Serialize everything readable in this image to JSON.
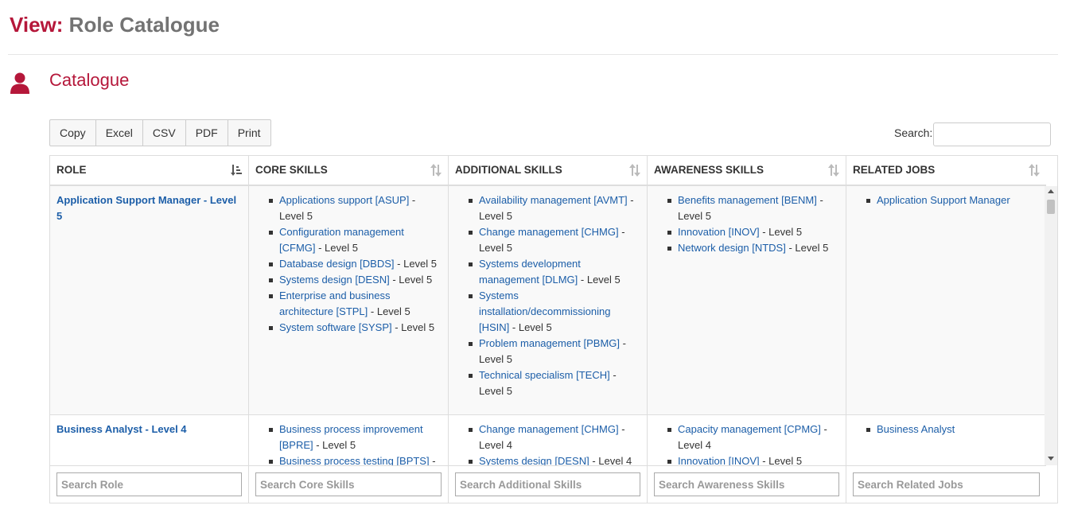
{
  "page": {
    "title_prefix": "View:",
    "title_name": "Role Catalogue"
  },
  "section": {
    "title": "Catalogue",
    "icon": "user-icon",
    "accent_color": "#b5173a"
  },
  "toolbar": {
    "buttons": [
      "Copy",
      "Excel",
      "CSV",
      "PDF",
      "Print"
    ]
  },
  "search": {
    "label": "Search:",
    "value": ""
  },
  "table": {
    "columns": [
      "ROLE",
      "CORE SKILLS",
      "ADDITIONAL SKILLS",
      "AWARENESS SKILLS",
      "RELATED JOBS"
    ],
    "rows": [
      {
        "role": "Application Support Manager - Level 5",
        "core": [
          {
            "skill": "Applications support [ASUP]",
            "level": " - Level 5"
          },
          {
            "skill": "Configuration management [CFMG]",
            "level": " - Level 5"
          },
          {
            "skill": "Database design [DBDS]",
            "level": " - Level 5"
          },
          {
            "skill": "Systems design [DESN]",
            "level": " - Level 5"
          },
          {
            "skill": "Enterprise and business architecture [STPL]",
            "level": " - Level 5"
          },
          {
            "skill": "System software [SYSP]",
            "level": " - Level 5"
          }
        ],
        "additional": [
          {
            "skill": "Availability management [AVMT]",
            "level": " - Level 5"
          },
          {
            "skill": "Change management [CHMG]",
            "level": " - Level 5"
          },
          {
            "skill": "Systems development management [DLMG]",
            "level": " - Level 5"
          },
          {
            "skill": "Systems installation/decommissioning [HSIN]",
            "level": " - Level 5"
          },
          {
            "skill": "Problem management [PBMG]",
            "level": " - Level 5"
          },
          {
            "skill": "Technical specialism [TECH]",
            "level": " - Level 5"
          }
        ],
        "awareness": [
          {
            "skill": "Benefits management [BENM]",
            "level": " - Level 5"
          },
          {
            "skill": "Innovation [INOV]",
            "level": " - Level 5"
          },
          {
            "skill": "Network design [NTDS]",
            "level": " - Level 5"
          }
        ],
        "related": [
          "Application Support Manager"
        ]
      },
      {
        "role": "Business Analyst - Level 4",
        "core": [
          {
            "skill": "Business process improvement [BPRE]",
            "level": " - Level 5"
          },
          {
            "skill": "Business process testing [BPTS]",
            "level": " -"
          }
        ],
        "additional": [
          {
            "skill": "Change management [CHMG]",
            "level": " - Level 4"
          },
          {
            "skill": "Systems design [DESN]",
            "level": " - Level 4"
          }
        ],
        "awareness": [
          {
            "skill": "Capacity management [CPMG]",
            "level": " - Level 4"
          },
          {
            "skill": "Innovation [INOV]",
            "level": " - Level 5"
          }
        ],
        "related": [
          "Business Analyst"
        ]
      }
    ],
    "footer_placeholders": [
      "Search Role",
      "Search Core Skills",
      "Search Additional Skills",
      "Search Awareness Skills",
      "Search Related Jobs"
    ]
  }
}
